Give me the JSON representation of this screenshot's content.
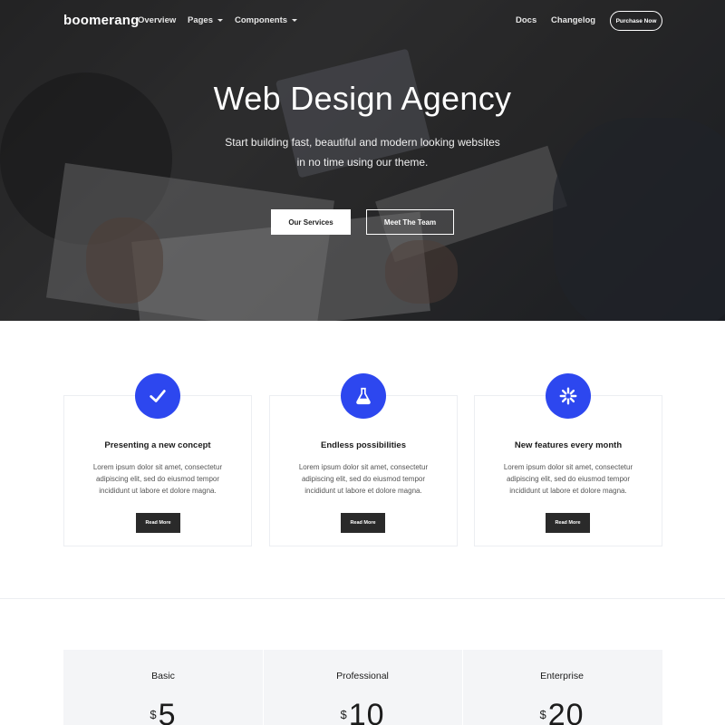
{
  "nav": {
    "brand": "boomerang",
    "links": [
      {
        "label": "Overview"
      },
      {
        "label": "Pages"
      },
      {
        "label": "Components"
      },
      {
        "label": "Docs"
      },
      {
        "label": "Changelog"
      }
    ],
    "purchase_label": "Purchase Now"
  },
  "hero": {
    "title": "Web Design Agency",
    "subtitle_line1": "Start building fast, beautiful and modern looking websites",
    "subtitle_line2": "in no time using our theme.",
    "primary_button": "Our Services",
    "secondary_button": "Meet The Team"
  },
  "features": [
    {
      "icon": "check-icon",
      "title": "Presenting a new concept",
      "text": "Lorem ipsum dolor sit amet, consectetur adipiscing elit, sed do eiusmod tempor incididunt ut labore et dolore magna.",
      "button": "Read More"
    },
    {
      "icon": "flask-icon",
      "title": "Endless possibilities",
      "text": "Lorem ipsum dolor sit amet, consectetur adipiscing elit, sed do eiusmod tempor incididunt ut labore et dolore magna.",
      "button": "Read More"
    },
    {
      "icon": "asterisk-icon",
      "title": "New features every month",
      "text": "Lorem ipsum dolor sit amet, consectetur adipiscing elit, sed do eiusmod tempor incididunt ut labore et dolore magna.",
      "button": "Read More"
    }
  ],
  "pricing": {
    "plans": [
      {
        "name": "Basic",
        "currency": "$",
        "amount": "5"
      },
      {
        "name": "Professional",
        "currency": "$",
        "amount": "10"
      },
      {
        "name": "Enterprise",
        "currency": "$",
        "amount": "20"
      }
    ]
  },
  "colors": {
    "accent": "#2d47ef",
    "dark_button": "#2a2a2a",
    "card_border": "#eceef2",
    "pricing_bg": "#f4f5f7"
  }
}
